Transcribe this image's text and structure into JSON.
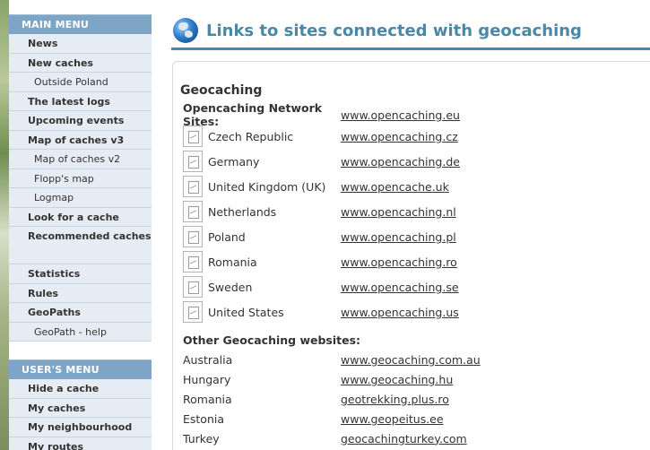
{
  "main_menu": {
    "header": "MAIN MENU",
    "items": [
      {
        "label": "News",
        "type": "main"
      },
      {
        "label": "New caches",
        "type": "main"
      },
      {
        "label": "Outside Poland",
        "type": "sub"
      },
      {
        "label": "The latest logs",
        "type": "main"
      },
      {
        "label": "Upcoming events",
        "type": "main"
      },
      {
        "label": "Map of caches v3",
        "type": "main"
      },
      {
        "label": "Map of caches v2",
        "type": "sub"
      },
      {
        "label": "Flopp's map",
        "type": "sub"
      },
      {
        "label": "Logmap",
        "type": "sub"
      },
      {
        "label": "Look for a cache",
        "type": "main"
      },
      {
        "label": "Recommended caches",
        "type": "tall"
      },
      {
        "label": "Statistics",
        "type": "main"
      },
      {
        "label": "Rules",
        "type": "main"
      },
      {
        "label": "GeoPaths",
        "type": "main"
      },
      {
        "label": "GeoPath - help",
        "type": "sub"
      }
    ]
  },
  "user_menu": {
    "header": "USER'S MENU",
    "items": [
      {
        "label": "Hide a cache"
      },
      {
        "label": "My caches"
      },
      {
        "label": "My neighbourhood"
      },
      {
        "label": "My routes"
      }
    ]
  },
  "page": {
    "title": "Links to sites connected with geocaching",
    "icon": "globe-icon",
    "section_title": "Geocaching",
    "oc_header_label": "Opencaching Network Sites:",
    "oc_header_link": "www.opencaching.eu",
    "oc_sites": [
      {
        "country": "Czech Republic",
        "url": "www.opencaching.cz"
      },
      {
        "country": "Germany",
        "url": "www.opencaching.de"
      },
      {
        "country": "United Kingdom (UK)",
        "url": "www.opencache.uk"
      },
      {
        "country": "Netherlands",
        "url": "www.opencaching.nl"
      },
      {
        "country": "Poland",
        "url": "www.opencaching.pl"
      },
      {
        "country": "Romania",
        "url": "www.opencaching.ro"
      },
      {
        "country": "Sweden",
        "url": "www.opencaching.se"
      },
      {
        "country": "United States",
        "url": "www.opencaching.us"
      }
    ],
    "other_header": "Other Geocaching websites:",
    "other_sites": [
      {
        "country": "Australia",
        "url": "www.geocaching.com.au"
      },
      {
        "country": "Hungary",
        "url": "www.geocaching.hu"
      },
      {
        "country": "Romania",
        "url": "geotrekking.plus.ro"
      },
      {
        "country": "Estonia",
        "url": "www.geopeitus.ee"
      },
      {
        "country": "Turkey",
        "url": "geocachingturkey.com"
      }
    ]
  },
  "colors": {
    "menu_header_bg": "#7ea5c6",
    "menu_bg": "#e6ecf3",
    "title_color": "#4a88a8"
  }
}
